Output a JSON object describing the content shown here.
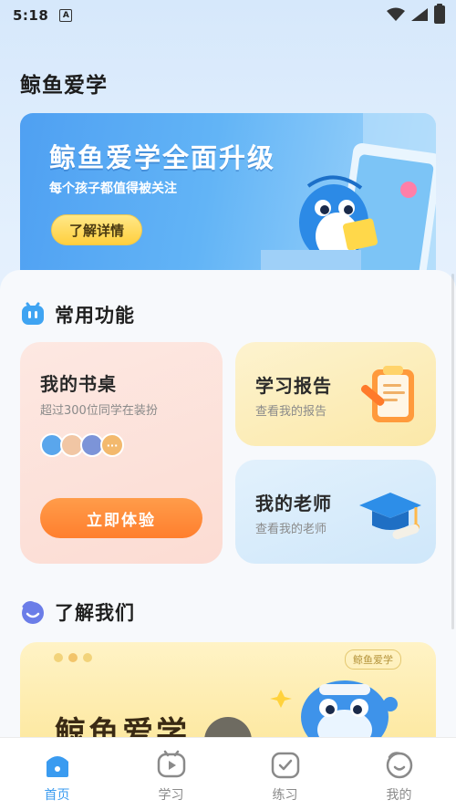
{
  "status_bar": {
    "time": "5:18",
    "notification_icon": "A"
  },
  "header": {
    "title": "鲸鱼爱学"
  },
  "banner": {
    "title": "鲸鱼爱学全面升级",
    "subtitle": "每个孩子都值得被关注",
    "button_label": "了解详情"
  },
  "functions": {
    "section_title": "常用功能",
    "desk": {
      "title": "我的书桌",
      "subtitle": "超过300位同学在装扮",
      "more_badge": "···",
      "button_label": "立即体验"
    },
    "report": {
      "title": "学习报告",
      "subtitle": "查看我的报告"
    },
    "teacher": {
      "title": "我的老师",
      "subtitle": "查看我的老师"
    }
  },
  "about": {
    "section_title": "了解我们",
    "tag": "鲸鱼爱学",
    "card_title": "鲸鱼爱学"
  },
  "tabbar": {
    "items": [
      {
        "label": "首页",
        "icon": "home-icon",
        "active": true
      },
      {
        "label": "学习",
        "icon": "play-icon",
        "active": false
      },
      {
        "label": "练习",
        "icon": "check-icon",
        "active": false
      },
      {
        "label": "我的",
        "icon": "profile-icon",
        "active": false
      }
    ]
  },
  "colors": {
    "accent": "#3a9bf0",
    "cta": "#ff8a3a",
    "banner": "#5aaaf4"
  }
}
